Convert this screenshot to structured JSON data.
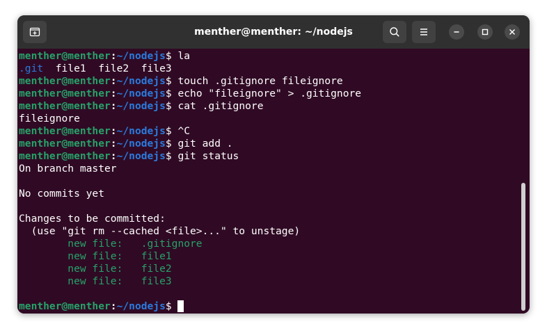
{
  "window": {
    "title": "menther@menther: ~/nodejs"
  },
  "toolbar": {
    "new_tab_icon": "new-tab-icon",
    "search_icon": "search-icon",
    "menu_icon": "hamburger-menu-icon",
    "minimize_icon": "minimize-icon",
    "maximize_icon": "maximize-icon",
    "close_icon": "close-icon"
  },
  "prompt": {
    "user": "menther@menther",
    "sep": ":",
    "path": "~/nodejs",
    "dollar": "$"
  },
  "terminal": {
    "cmd_la": " la",
    "ls_dir": ".git",
    "ls_files": "  file1  file2  file3",
    "cmd_touch": " touch .gitignore fileignore",
    "cmd_echo": " echo \"fileignore\" > .gitignore",
    "cmd_cat": " cat .gitignore",
    "out_cat": "fileignore",
    "cmd_ctrlc": " ^C",
    "cmd_add": " git add .",
    "cmd_status": " git status",
    "out_branch": "On branch master",
    "out_nocommits": "No commits yet",
    "out_changes": "Changes to be committed:",
    "out_hint": "  (use \"git rm --cached <file>...\" to unstage)",
    "staged": [
      "        new file:   .gitignore",
      "        new file:   file1",
      "        new file:   file2",
      "        new file:   file3"
    ],
    "cmd_final": " "
  },
  "colors": {
    "background": "#300a24",
    "titlebar": "#303030",
    "prompt_user": "#26a269",
    "prompt_path": "#2a7bde"
  }
}
